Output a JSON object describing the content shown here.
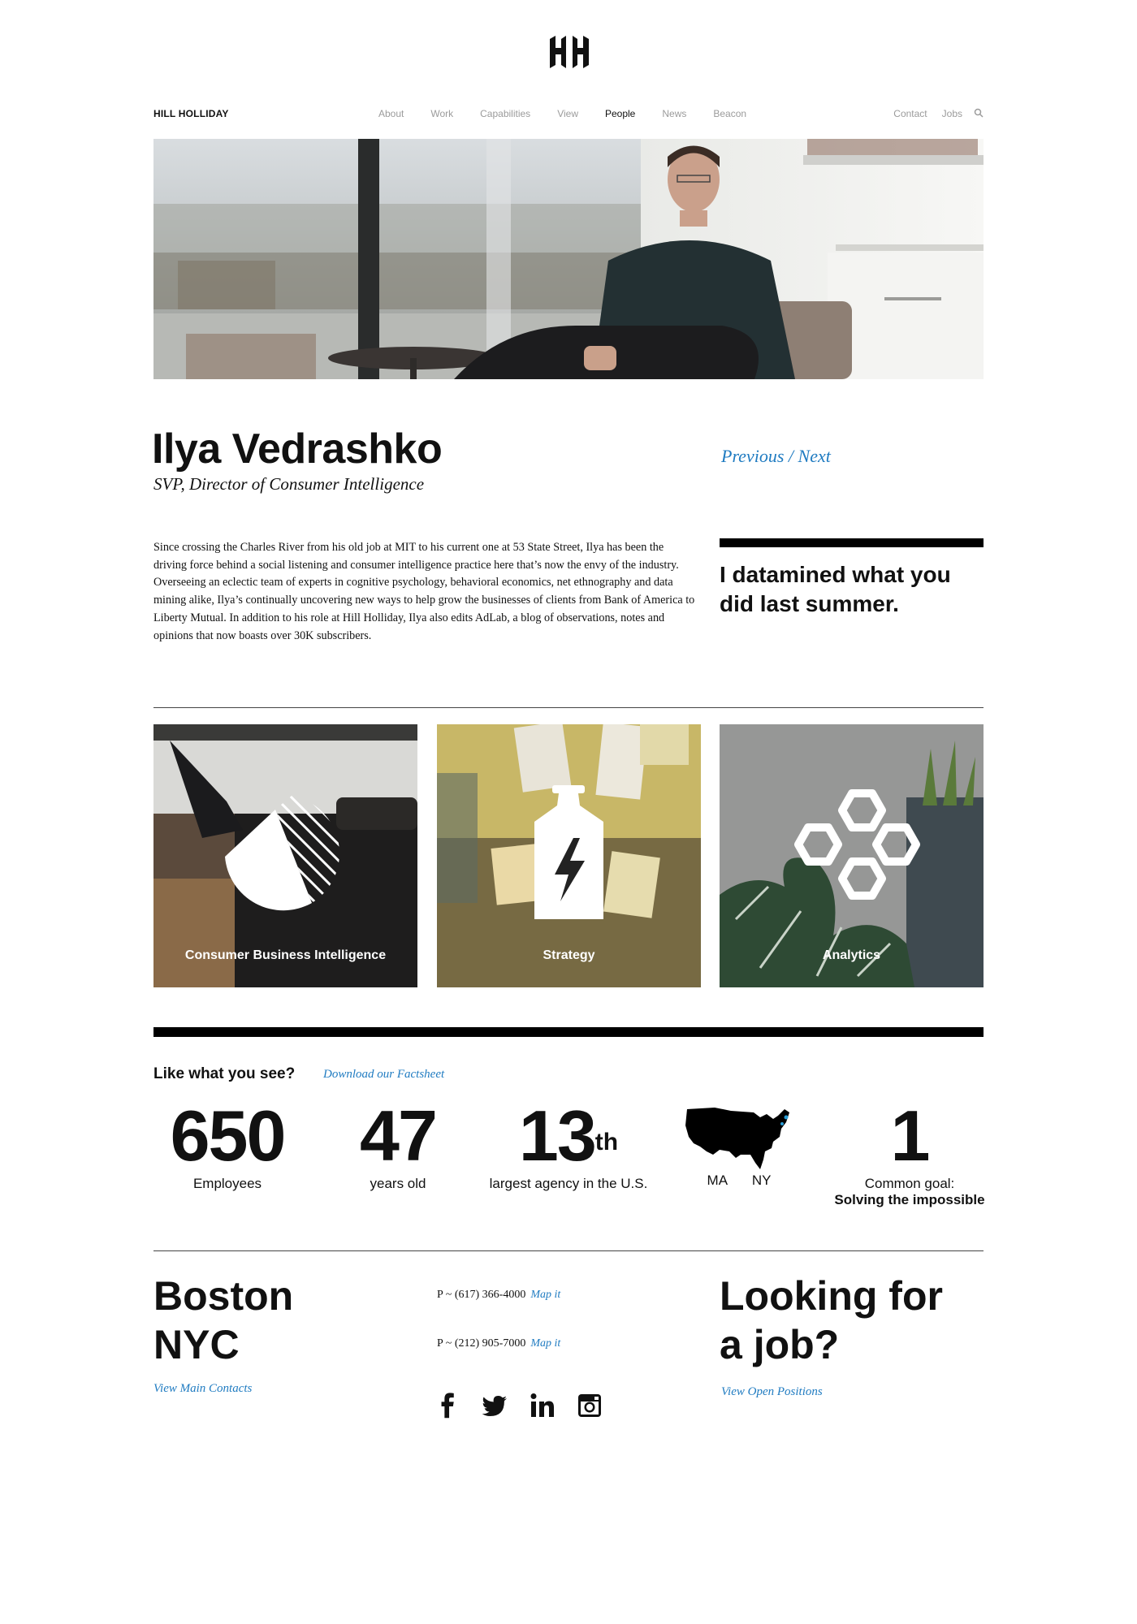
{
  "brand": "HILL HOLLIDAY",
  "nav": {
    "items": [
      "About",
      "Work",
      "Capabilities",
      "View",
      "People",
      "News",
      "Beacon"
    ],
    "active": "People",
    "right_items": [
      "Contact",
      "Jobs"
    ],
    "search_icon": "search-icon"
  },
  "profile": {
    "name": "Ilya Vedrashko",
    "title": "SVP, Director of Consumer Intelligence",
    "previous_label": "Previous",
    "separator": " / ",
    "next_label": "Next",
    "bio": "Since crossing the Charles River from his old job at MIT to his current one at 53 State Street, Ilya has been the driving force behind a social listening and consumer intelligence practice here that’s now the envy of the industry. Overseeing an eclectic team of experts in cognitive psychology, behavioral economics, net ethnography and data mining alike, Ilya’s continually uncovering new ways to help grow the businesses of clients from Bank of America to Liberty Mutual. In addition to his role at Hill Holliday, Ilya also edits AdLab, a blog of observations, notes and opinions that now boasts over 30K subscribers.",
    "quote": "I datamined what you did last summer."
  },
  "capabilities": [
    {
      "label": "Consumer Business Intelligence",
      "icon": "pie-chart-icon"
    },
    {
      "label": "Strategy",
      "icon": "bottle-lightning-icon"
    },
    {
      "label": "Analytics",
      "icon": "hexagons-icon"
    }
  ],
  "facts": {
    "heading": "Like what you see?",
    "download_label": "Download our Factsheet",
    "employees": {
      "value": "650",
      "label": "Employees"
    },
    "age": {
      "value": "47",
      "label": "years old"
    },
    "rank": {
      "value": "13",
      "suffix": "th",
      "label": "largest agency in the U.S."
    },
    "offices": {
      "label": "MA NY",
      "icon": "usa-map-icon"
    },
    "goal": {
      "value": "1",
      "label": "Common goal:",
      "label_bold": "Solving the impossible"
    }
  },
  "footer": {
    "city1": "Boston",
    "city2": "NYC",
    "contacts_link": "View Main Contacts",
    "phone1": "P ~ (617) 366-4000",
    "phone2": "P ~ (212) 905-7000",
    "map_label": "Map it",
    "job_heading_1": "Looking for",
    "job_heading_2": "a job?",
    "jobs_link": "View Open Positions"
  },
  "colors": {
    "link": "#1f7bc1",
    "text": "#111111",
    "nav_muted": "#9b9b9b"
  }
}
